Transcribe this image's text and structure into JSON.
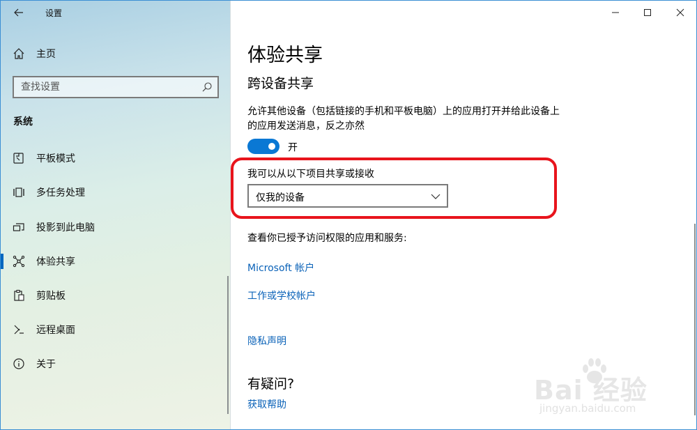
{
  "window": {
    "title": "设置",
    "caption_buttons": [
      "minimize-icon",
      "maximize-icon",
      "close-icon"
    ]
  },
  "sidebar": {
    "home_label": "主页",
    "search_placeholder": "查找设置",
    "section_label": "系统",
    "items": [
      {
        "label": "平板模式",
        "icon": "tablet-mode-icon",
        "active": false
      },
      {
        "label": "多任务处理",
        "icon": "multitasking-icon",
        "active": false
      },
      {
        "label": "投影到此电脑",
        "icon": "projecting-icon",
        "active": false
      },
      {
        "label": "体验共享",
        "icon": "shared-experiences-icon",
        "active": true
      },
      {
        "label": "剪贴板",
        "icon": "clipboard-icon",
        "active": false
      },
      {
        "label": "远程桌面",
        "icon": "remote-desktop-icon",
        "active": false
      },
      {
        "label": "关于",
        "icon": "info-icon",
        "active": false
      }
    ]
  },
  "main": {
    "title": "体验共享",
    "section_title": "跨设备共享",
    "description": "允许其他设备（包括链接的手机和平板电脑）上的应用打开并给此设备上的应用发送消息，反之亦然",
    "toggle": {
      "state": "on",
      "label": "开"
    },
    "share_from_label": "我可以从以下项目共享或接收",
    "share_from_value": "仅我的设备",
    "access_label": "查看你已授予访问权限的应用和服务:",
    "links": [
      "Microsoft 帐户",
      "工作或学校帐户",
      "隐私声明"
    ],
    "faq_title": "有疑问?",
    "faq_link": "获取帮助"
  },
  "watermark": {
    "brand": "Bai 经验",
    "url": "jingyan.baidu.com"
  },
  "colors": {
    "accent": "#0a78d4",
    "link": "#0a62b8",
    "highlight": "#e8141c"
  }
}
